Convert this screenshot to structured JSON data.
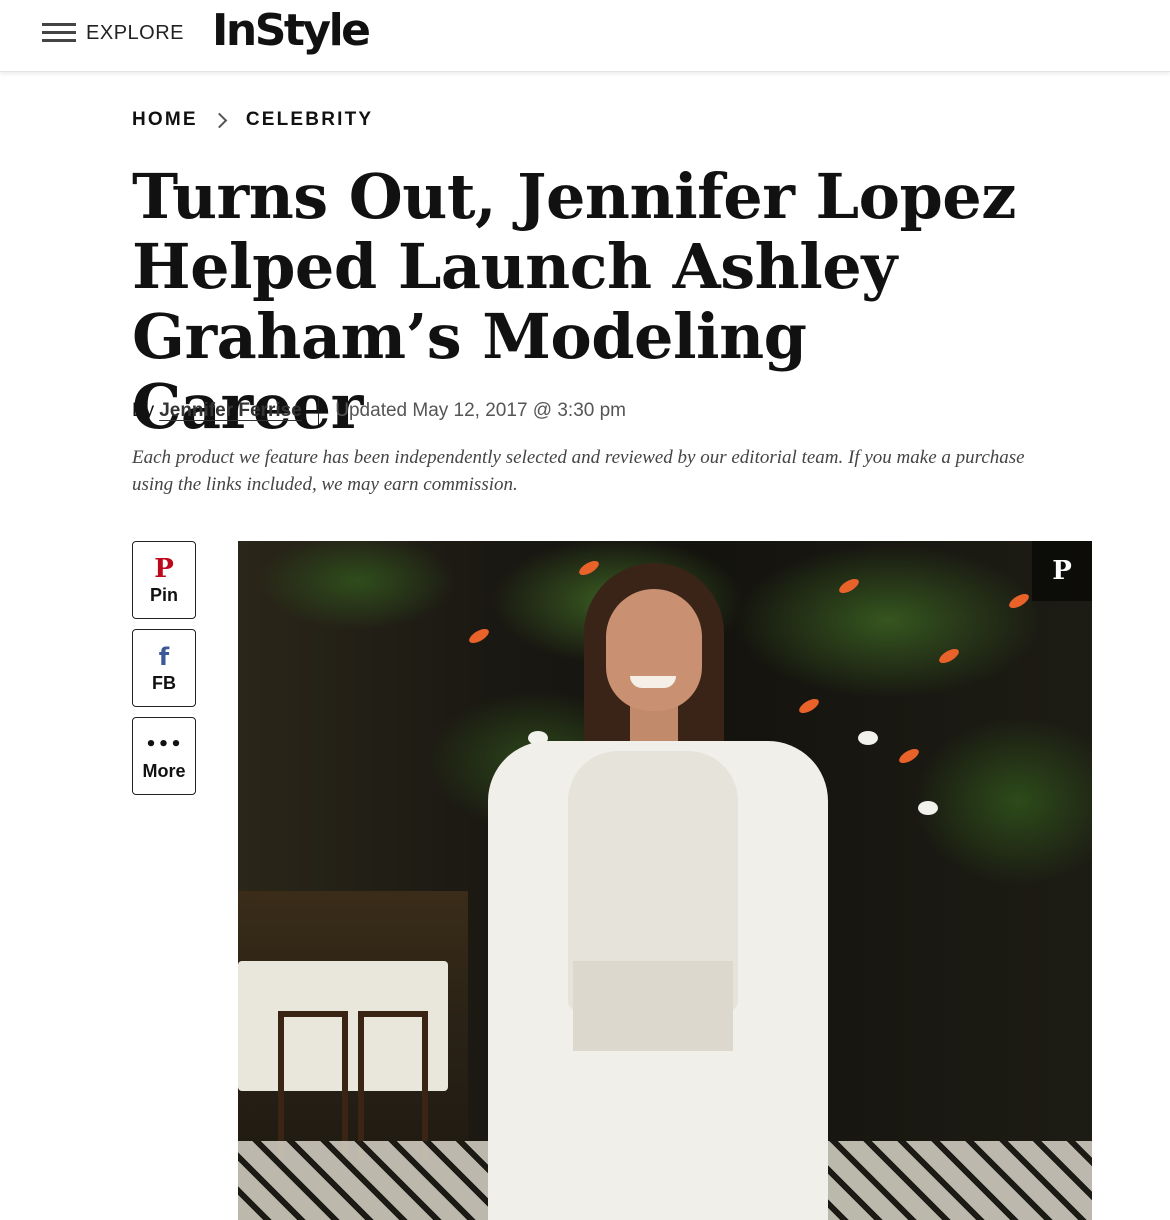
{
  "header": {
    "menu_label": "EXPLORE",
    "logo_text": "InStyle"
  },
  "breadcrumb": {
    "items": [
      "HOME",
      "CELEBRITY"
    ]
  },
  "article": {
    "title_lines": [
      "Turns Out, Jennifer Lopez",
      "Helped Launch Ashley",
      "Graham’s Modeling Career"
    ],
    "byline_prefix": "By",
    "author": "Jennifer Ferrise",
    "updated": "Updated May 12, 2017 @ 3:30 pm",
    "disclaimer": "Each product we feature has been independently selected and reviewed by our editorial team. If you make a purchase using the links included, we may earn commission."
  },
  "share": {
    "pin_label": "Pin",
    "pin_icon": "P",
    "fb_label": "FB",
    "fb_icon": "f",
    "more_label": "More",
    "more_icon": "•••"
  },
  "hero": {
    "pin_icon": "P",
    "pin_icon_name": "pinterest-icon"
  },
  "colors": {
    "pinterest": "#bd081c",
    "facebook": "#3b5998",
    "text": "#111111"
  }
}
